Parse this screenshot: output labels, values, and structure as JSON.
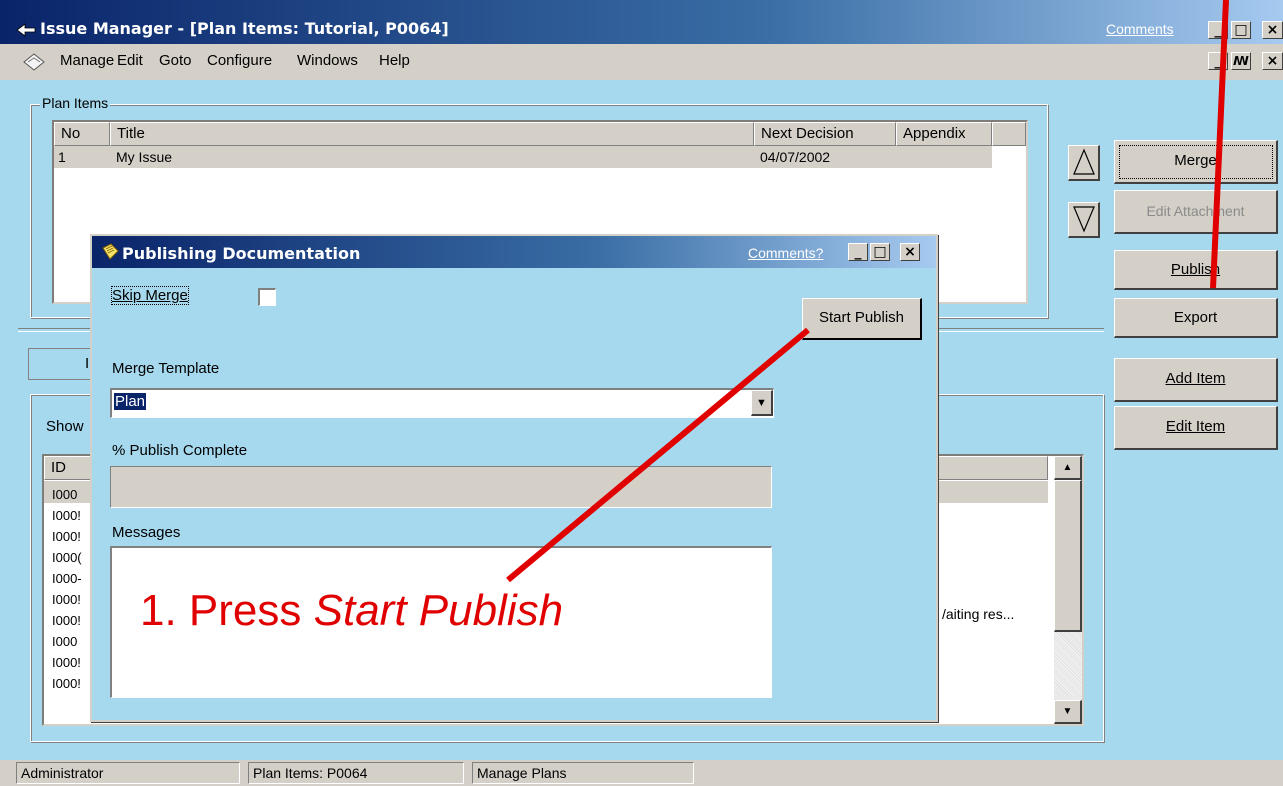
{
  "window": {
    "title": "Issue Manager - [Plan Items: Tutorial, P0064]",
    "comments_link": "Comments",
    "minimize_glyph": "_",
    "maximize_glyph": "□",
    "close_glyph": "×",
    "restore_glyph": "🗗"
  },
  "menu": {
    "items": [
      "Manage",
      "Edit",
      "Goto",
      "Configure",
      "Windows",
      "Help"
    ]
  },
  "plan_items": {
    "group_label": "Plan Items",
    "columns": [
      "No",
      "Title",
      "Next Decision",
      "Appendix"
    ],
    "rows": [
      {
        "no": "1",
        "title": "My Issue",
        "next_decision": "04/07/2002",
        "appendix": ""
      }
    ]
  },
  "side_buttons": {
    "up_arrow": "up-arrow",
    "down_arrow": "down-arrow",
    "merge": "Merge",
    "edit_attachment": "Edit Attachment",
    "publish": "Publish",
    "export": "Export",
    "add_item": "Add Item",
    "edit_item": "Edit Item"
  },
  "lower_panel": {
    "tab_fragment": "I",
    "show_label": "Show",
    "id_column": "ID",
    "id_rows": [
      "I000",
      "I000!",
      "I000!",
      "I000(",
      "I000-",
      "I000!",
      "I000!",
      "I000",
      "I000!",
      "I000!"
    ],
    "truncated_cell": "/aiting res..."
  },
  "status_bar": {
    "panels": [
      "Administrator",
      "Plan Items: P0064",
      "Manage Plans"
    ]
  },
  "dialog": {
    "title": "Publishing Documentation",
    "comments_link": "Comments?",
    "skip_merge_label": "Skip Merge",
    "skip_merge_checked": false,
    "start_publish_button": "Start Publish",
    "merge_template_label": "Merge Template",
    "merge_template_value": "Plan",
    "publish_complete_label": "% Publish Complete",
    "publish_complete_progress": 0,
    "messages_label": "Messages",
    "messages_value": ""
  },
  "annotation": {
    "text_prefix": "1. Press ",
    "text_emphasis": "Start Publish",
    "color": "#e00000"
  },
  "colors": {
    "client_background": "#a6d9ee",
    "title_gradient_start": "#0a246a",
    "selected_row": "#d4d0c8",
    "annotation_red": "#e00000"
  }
}
